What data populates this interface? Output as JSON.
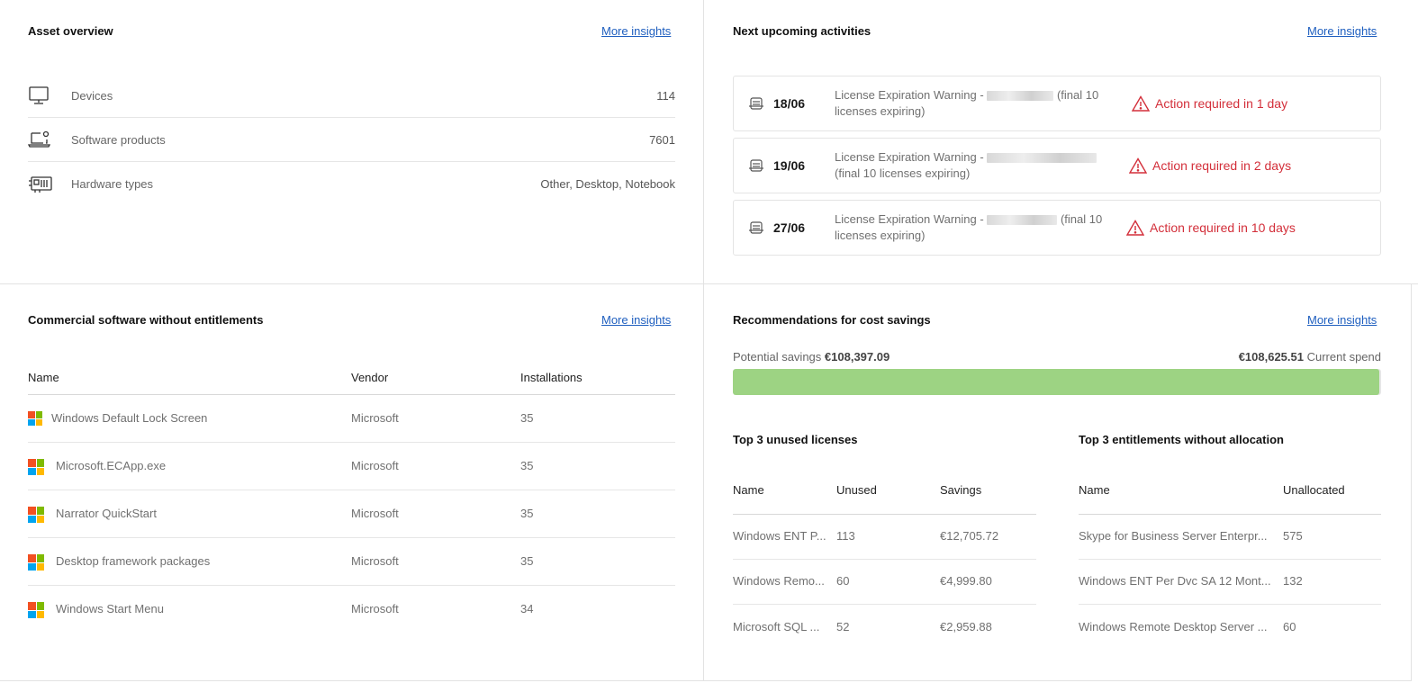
{
  "asset_overview": {
    "title": "Asset overview",
    "more_link": "More insights",
    "rows": [
      {
        "icon": "monitor-icon",
        "label": "Devices",
        "value": "114"
      },
      {
        "icon": "laptop-gear-icon",
        "label": "Software products",
        "value": "7601"
      },
      {
        "icon": "hardware-chip-icon",
        "label": "Hardware types",
        "value": "Other, Desktop, Notebook"
      }
    ]
  },
  "activities": {
    "title": "Next upcoming activities",
    "more_link": "More insights",
    "items": [
      {
        "date": "18/06",
        "text_a": "License Expiration Warning - ",
        "text_b": " (final 10 licenses expiring)",
        "warning": "Action required in 1 day"
      },
      {
        "date": "19/06",
        "text_a": "License Expiration Warning - ",
        "text_b": " (final 10 licenses expiring)",
        "warning": "Action required in 2 days"
      },
      {
        "date": "27/06",
        "text_a": "License Expiration Warning - ",
        "text_b": " (final 10 licenses expiring)",
        "warning": "Action required in 10 days"
      }
    ],
    "warning_color": "#d32f3a"
  },
  "commercial": {
    "title": "Commercial software without entitlements",
    "more_link": "More insights",
    "columns": [
      "Name",
      "Vendor",
      "Installations"
    ],
    "rows": [
      {
        "name": "Windows Default Lock Screen",
        "vendor": "Microsoft",
        "installations": "35"
      },
      {
        "name": "Microsoft.ECApp.exe",
        "vendor": "Microsoft",
        "installations": "35"
      },
      {
        "name": "Narrator QuickStart",
        "vendor": "Microsoft",
        "installations": "35"
      },
      {
        "name": "Desktop framework packages",
        "vendor": "Microsoft",
        "installations": "35"
      },
      {
        "name": "Windows Start Menu",
        "vendor": "Microsoft",
        "installations": "34"
      }
    ]
  },
  "savings": {
    "title": "Recommendations for cost savings",
    "more_link": "More insights",
    "potential_label": "Potential savings",
    "potential_value": "€108,397.09",
    "current_value": "€108,625.51",
    "current_label": "Current spend",
    "bar_fraction": 0.9979,
    "bar_color": "#9dd383",
    "unused": {
      "title": "Top 3 unused licenses",
      "columns": [
        "Name",
        "Unused",
        "Savings"
      ],
      "rows": [
        {
          "name": "Windows ENT P...",
          "unused": "113",
          "savings": "€12,705.72"
        },
        {
          "name": "Windows Remo...",
          "unused": "60",
          "savings": "€4,999.80"
        },
        {
          "name": "Microsoft SQL ...",
          "unused": "52",
          "savings": "€2,959.88"
        }
      ]
    },
    "unallocated": {
      "title": "Top 3 entitlements without allocation",
      "columns": [
        "Name",
        "Unallocated"
      ],
      "rows": [
        {
          "name": "Skype for Business Server Enterpr...",
          "unallocated": "575"
        },
        {
          "name": "Windows ENT Per Dvc SA 12 Mont...",
          "unallocated": "132"
        },
        {
          "name": "Windows Remote Desktop Server ...",
          "unallocated": "60"
        }
      ]
    }
  }
}
